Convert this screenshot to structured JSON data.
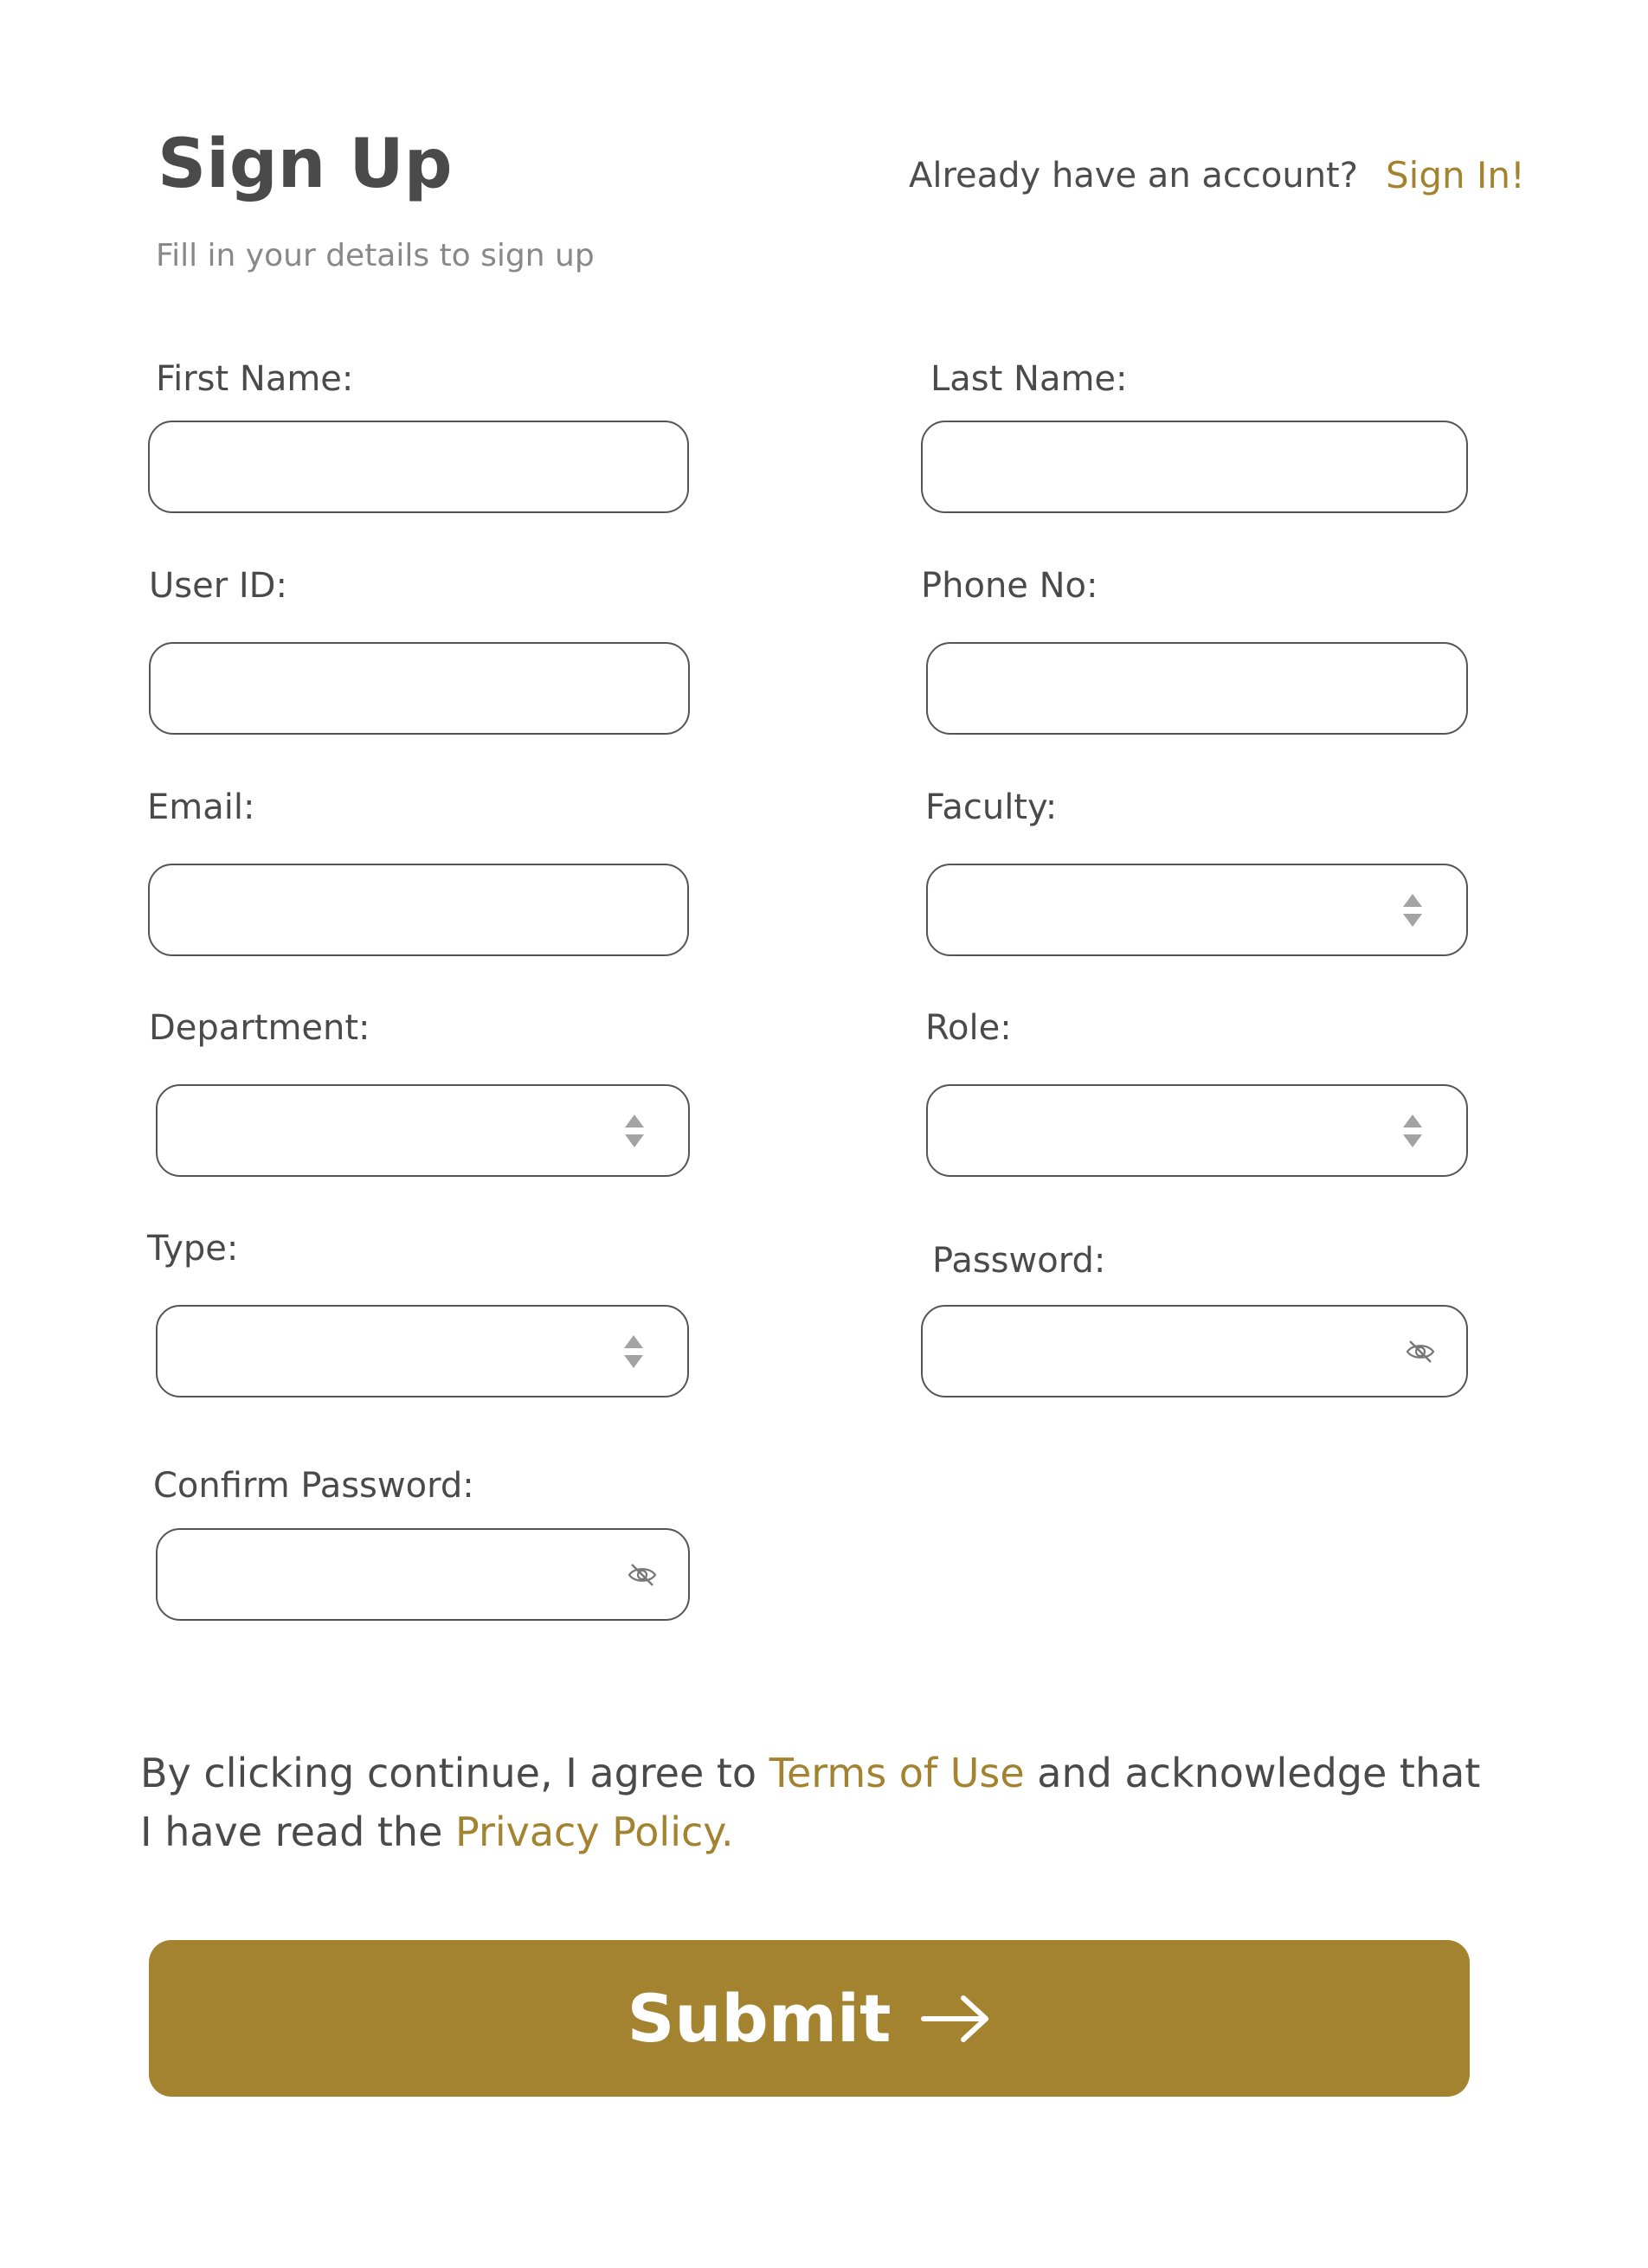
{
  "header": {
    "title": "Sign Up",
    "subtitle": "Fill in your details to sign up",
    "already_text": "Already have an account?",
    "signin_link": "Sign In!"
  },
  "fields": {
    "first_name": {
      "label": "First Name:",
      "value": ""
    },
    "last_name": {
      "label": "Last Name:",
      "value": ""
    },
    "user_id": {
      "label": "User ID:",
      "value": ""
    },
    "phone": {
      "label": "Phone No:",
      "value": ""
    },
    "email": {
      "label": "Email:",
      "value": ""
    },
    "faculty": {
      "label": "Faculty:",
      "value": ""
    },
    "department": {
      "label": "Department:",
      "value": ""
    },
    "role": {
      "label": "Role:",
      "value": ""
    },
    "type": {
      "label": "Type:",
      "value": ""
    },
    "password": {
      "label": "Password:",
      "value": ""
    },
    "confirm_password": {
      "label": "Confirm Password:",
      "value": ""
    }
  },
  "terms": {
    "prefix": "By clicking continue, I agree to ",
    "terms_link": "Terms of Use",
    "middle": " and acknowledge that I have read the ",
    "privacy_link": "Privacy Policy."
  },
  "submit": {
    "label": "Submit"
  },
  "icons": {
    "select": "up-down-caret-icon",
    "password": "eye-off-icon",
    "submit": "arrow-right-icon"
  },
  "colors": {
    "accent": "#a38330",
    "text": "#4a4a4a",
    "muted": "#888888",
    "border": "#555555",
    "button_text": "#ffffff"
  }
}
